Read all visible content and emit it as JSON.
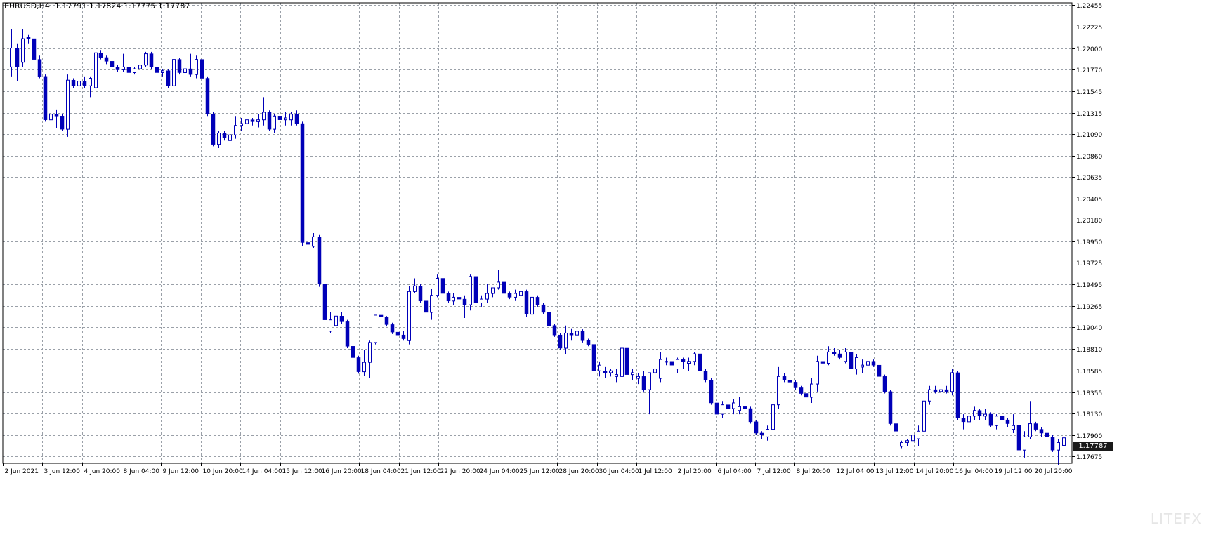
{
  "title_line": "EURUSD,H4  1.17791 1.17824 1.17775 1.17787",
  "current_price": "1.17787",
  "watermark": "LITEFX",
  "colors": {
    "candle": "#0000b8",
    "grid": "#9aa0a8",
    "background": "#ffffff",
    "axis": "#000000",
    "current_price_line": "#a0a8b8",
    "current_price_box": "#1a1a1a"
  },
  "chart_data": {
    "type": "candlestick",
    "symbol": "EURUSD",
    "timeframe": "H4",
    "ylim": [
      1.176,
      1.2248
    ],
    "price_ticks": [
      "1.22455",
      "1.22225",
      "1.22000",
      "1.21770",
      "1.21545",
      "1.21315",
      "1.21090",
      "1.20860",
      "1.20635",
      "1.20405",
      "1.20180",
      "1.19950",
      "1.19725",
      "1.19495",
      "1.19265",
      "1.19040",
      "1.18810",
      "1.18585",
      "1.18355",
      "1.18130",
      "1.17900",
      "1.17675"
    ],
    "time_ticks": [
      "2 Jun 2021",
      "3 Jun 12:00",
      "4 Jun 20:00",
      "8 Jun 04:00",
      "9 Jun 12:00",
      "10 Jun 20:00",
      "14 Jun 04:00",
      "15 Jun 12:00",
      "16 Jun 20:00",
      "18 Jun 04:00",
      "21 Jun 12:00",
      "22 Jun 20:00",
      "24 Jun 04:00",
      "25 Jun 12:00",
      "28 Jun 20:00",
      "30 Jun 04:00",
      "1 Jul 12:00",
      "2 Jul 20:00",
      "6 Jul 04:00",
      "7 Jul 12:00",
      "8 Jul 20:00",
      "12 Jul 04:00",
      "13 Jul 12:00",
      "14 Jul 20:00",
      "16 Jul 04:00",
      "19 Jul 12:00",
      "20 Jul 20:00"
    ],
    "candles": [
      [
        1.218,
        1.222,
        1.217,
        1.22
      ],
      [
        1.22,
        1.2205,
        1.2165,
        1.218
      ],
      [
        1.2185,
        1.222,
        1.218,
        1.221
      ],
      [
        1.2212,
        1.2214,
        1.2205,
        1.221
      ],
      [
        1.221,
        1.2212,
        1.2185,
        1.2188
      ],
      [
        1.2188,
        1.2192,
        1.2168,
        1.217
      ],
      [
        1.217,
        1.2172,
        1.2122,
        1.2124
      ],
      [
        1.2124,
        1.214,
        1.212,
        1.213
      ],
      [
        1.213,
        1.2135,
        1.2115,
        1.2128
      ],
      [
        1.2128,
        1.213,
        1.2112,
        1.2114
      ],
      [
        1.2114,
        1.2172,
        1.2106,
        1.2166
      ],
      [
        1.2166,
        1.2168,
        1.2158,
        1.216
      ],
      [
        1.216,
        1.2168,
        1.2152,
        1.2165
      ],
      [
        1.2165,
        1.217,
        1.2158,
        1.216
      ],
      [
        1.216,
        1.217,
        1.2148,
        1.2168
      ],
      [
        1.2158,
        1.2202,
        1.2155,
        1.2195
      ],
      [
        1.2195,
        1.2198,
        1.2188,
        1.219
      ],
      [
        1.219,
        1.2192,
        1.2183,
        1.2186
      ],
      [
        1.2186,
        1.2188,
        1.2178,
        1.218
      ],
      [
        1.218,
        1.2182,
        1.2175,
        1.2177
      ],
      [
        1.2177,
        1.2194,
        1.2175,
        1.218
      ],
      [
        1.218,
        1.2182,
        1.2172,
        1.2174
      ],
      [
        1.2174,
        1.218,
        1.2172,
        1.2178
      ],
      [
        1.2178,
        1.2184,
        1.2172,
        1.2182
      ],
      [
        1.2182,
        1.2196,
        1.218,
        1.2194
      ],
      [
        1.2194,
        1.2196,
        1.2178,
        1.218
      ],
      [
        1.218,
        1.2185,
        1.2172,
        1.2174
      ],
      [
        1.2174,
        1.2178,
        1.217,
        1.2176
      ],
      [
        1.2176,
        1.2178,
        1.2158,
        1.216
      ],
      [
        1.216,
        1.2192,
        1.2152,
        1.2188
      ],
      [
        1.2188,
        1.219,
        1.2172,
        1.2174
      ],
      [
        1.2174,
        1.2182,
        1.2168,
        1.2178
      ],
      [
        1.2178,
        1.2194,
        1.217,
        1.2172
      ],
      [
        1.2172,
        1.2192,
        1.2168,
        1.2188
      ],
      [
        1.2188,
        1.219,
        1.2166,
        1.2168
      ],
      [
        1.2168,
        1.217,
        1.2128,
        1.213
      ],
      [
        1.213,
        1.2132,
        1.2096,
        1.2098
      ],
      [
        1.2098,
        1.2112,
        1.2094,
        1.211
      ],
      [
        1.211,
        1.2112,
        1.2102,
        1.2105
      ],
      [
        1.2102,
        1.2112,
        1.2096,
        1.2108
      ],
      [
        1.2108,
        1.2128,
        1.2104,
        1.2118
      ],
      [
        1.2118,
        1.2126,
        1.2112,
        1.212
      ],
      [
        1.212,
        1.2132,
        1.2116,
        1.2124
      ],
      [
        1.2124,
        1.2126,
        1.2118,
        1.2122
      ],
      [
        1.2122,
        1.213,
        1.2116,
        1.2124
      ],
      [
        1.2124,
        1.2148,
        1.2118,
        1.2132
      ],
      [
        1.2132,
        1.2134,
        1.2112,
        1.2114
      ],
      [
        1.2114,
        1.213,
        1.211,
        1.2128
      ],
      [
        1.2128,
        1.213,
        1.212,
        1.2124
      ],
      [
        1.2124,
        1.2132,
        1.2118,
        1.2126
      ],
      [
        1.2124,
        1.2132,
        1.2118,
        1.213
      ],
      [
        1.213,
        1.2134,
        1.2118,
        1.212
      ],
      [
        1.212,
        1.2122,
        1.199,
        1.1994
      ],
      [
        1.1994,
        1.1996,
        1.1988,
        1.1992
      ],
      [
        1.199,
        1.2004,
        1.1988,
        1.2
      ],
      [
        1.2,
        1.2002,
        1.1947,
        1.195
      ],
      [
        1.195,
        1.1952,
        1.191,
        1.1912
      ],
      [
        1.19,
        1.192,
        1.1898,
        1.1912
      ],
      [
        1.1906,
        1.1922,
        1.19,
        1.1916
      ],
      [
        1.1916,
        1.192,
        1.1908,
        1.191
      ],
      [
        1.191,
        1.1912,
        1.1882,
        1.1884
      ],
      [
        1.1884,
        1.1886,
        1.187,
        1.1872
      ],
      [
        1.1872,
        1.1874,
        1.1855,
        1.1857
      ],
      [
        1.1857,
        1.188,
        1.1853,
        1.1867
      ],
      [
        1.1867,
        1.189,
        1.185,
        1.1888
      ],
      [
        1.1888,
        1.191,
        1.1886,
        1.1917
      ],
      [
        1.1917,
        1.1918,
        1.1912,
        1.1915
      ],
      [
        1.1915,
        1.1916,
        1.1905,
        1.1907
      ],
      [
        1.1907,
        1.1909,
        1.1897,
        1.1899
      ],
      [
        1.1899,
        1.1902,
        1.1893,
        1.1896
      ],
      [
        1.1896,
        1.19,
        1.189,
        1.1892
      ],
      [
        1.189,
        1.1948,
        1.1886,
        1.1942
      ],
      [
        1.1942,
        1.1956,
        1.194,
        1.1948
      ],
      [
        1.1948,
        1.195,
        1.193,
        1.1932
      ],
      [
        1.1932,
        1.1935,
        1.1918,
        1.192
      ],
      [
        1.192,
        1.1945,
        1.1912,
        1.1938
      ],
      [
        1.1938,
        1.196,
        1.1936,
        1.1956
      ],
      [
        1.1956,
        1.1958,
        1.1938,
        1.194
      ],
      [
        1.194,
        1.1942,
        1.193,
        1.1932
      ],
      [
        1.1932,
        1.194,
        1.1928,
        1.1936
      ],
      [
        1.1936,
        1.194,
        1.193,
        1.1934
      ],
      [
        1.1934,
        1.1938,
        1.1914,
        1.1928
      ],
      [
        1.1928,
        1.196,
        1.1922,
        1.1958
      ],
      [
        1.1958,
        1.196,
        1.1928,
        1.193
      ],
      [
        1.193,
        1.1938,
        1.1926,
        1.1934
      ],
      [
        1.1934,
        1.195,
        1.193,
        1.194
      ],
      [
        1.194,
        1.1946,
        1.1936,
        1.1946
      ],
      [
        1.1946,
        1.1965,
        1.1944,
        1.1952
      ],
      [
        1.1952,
        1.1955,
        1.1938,
        1.194
      ],
      [
        1.194,
        1.1942,
        1.1934,
        1.1936
      ],
      [
        1.1936,
        1.1944,
        1.1932,
        1.194
      ],
      [
        1.1938,
        1.1944,
        1.192,
        1.1942
      ],
      [
        1.1942,
        1.1944,
        1.1915,
        1.1918
      ],
      [
        1.1918,
        1.1944,
        1.1914,
        1.1936
      ],
      [
        1.1936,
        1.1938,
        1.1926,
        1.1928
      ],
      [
        1.1928,
        1.193,
        1.1918,
        1.192
      ],
      [
        1.192,
        1.1922,
        1.1904,
        1.1906
      ],
      [
        1.1906,
        1.1908,
        1.1894,
        1.1896
      ],
      [
        1.1896,
        1.1898,
        1.188,
        1.1882
      ],
      [
        1.1882,
        1.1906,
        1.1876,
        1.1898
      ],
      [
        1.1898,
        1.1903,
        1.189,
        1.1896
      ],
      [
        1.1896,
        1.1902,
        1.189,
        1.19
      ],
      [
        1.19,
        1.1902,
        1.1888,
        1.189
      ],
      [
        1.189,
        1.1892,
        1.1884,
        1.1886
      ],
      [
        1.1886,
        1.1888,
        1.1856,
        1.1858
      ],
      [
        1.1858,
        1.1868,
        1.1852,
        1.1864
      ],
      [
        1.1858,
        1.1862,
        1.185,
        1.1856
      ],
      [
        1.1856,
        1.186,
        1.1852,
        1.1858
      ],
      [
        1.1852,
        1.186,
        1.1846,
        1.1854
      ],
      [
        1.1852,
        1.1886,
        1.1848,
        1.1882
      ],
      [
        1.1882,
        1.1884,
        1.1852,
        1.1854
      ],
      [
        1.1854,
        1.186,
        1.1848,
        1.1856
      ],
      [
        1.185,
        1.1856,
        1.1844,
        1.1852
      ],
      [
        1.1852,
        1.1858,
        1.1836,
        1.1838
      ],
      [
        1.1838,
        1.1856,
        1.1812,
        1.1856
      ],
      [
        1.1856,
        1.187,
        1.1852,
        1.186
      ],
      [
        1.185,
        1.1878,
        1.1846,
        1.187
      ],
      [
        1.1868,
        1.1872,
        1.1864,
        1.1868
      ],
      [
        1.1868,
        1.1872,
        1.1856,
        1.1864
      ],
      [
        1.186,
        1.1872,
        1.1856,
        1.187
      ],
      [
        1.187,
        1.1872,
        1.186,
        1.1868
      ],
      [
        1.1866,
        1.1872,
        1.1858,
        1.1868
      ],
      [
        1.1868,
        1.1878,
        1.1864,
        1.1876
      ],
      [
        1.1876,
        1.1878,
        1.1856,
        1.1858
      ],
      [
        1.1858,
        1.186,
        1.1846,
        1.1848
      ],
      [
        1.1848,
        1.185,
        1.1822,
        1.1824
      ],
      [
        1.1824,
        1.1828,
        1.181,
        1.1812
      ],
      [
        1.1812,
        1.1826,
        1.1808,
        1.1822
      ],
      [
        1.1822,
        1.1824,
        1.1816,
        1.1818
      ],
      [
        1.1818,
        1.1828,
        1.1812,
        1.1824
      ],
      [
        1.1816,
        1.183,
        1.1812,
        1.182
      ],
      [
        1.182,
        1.1822,
        1.1816,
        1.1818
      ],
      [
        1.1818,
        1.182,
        1.1802,
        1.1804
      ],
      [
        1.1804,
        1.1806,
        1.179,
        1.1792
      ],
      [
        1.1792,
        1.1794,
        1.1786,
        1.179
      ],
      [
        1.1788,
        1.18,
        1.1784,
        1.1796
      ],
      [
        1.1796,
        1.1828,
        1.179,
        1.1822
      ],
      [
        1.1822,
        1.1862,
        1.1818,
        1.1852
      ],
      [
        1.1852,
        1.1856,
        1.1846,
        1.1848
      ],
      [
        1.1848,
        1.185,
        1.1842,
        1.1846
      ],
      [
        1.1846,
        1.1848,
        1.1838,
        1.184
      ],
      [
        1.184,
        1.1842,
        1.1832,
        1.1834
      ],
      [
        1.1834,
        1.1836,
        1.1826,
        1.183
      ],
      [
        1.183,
        1.185,
        1.1824,
        1.1844
      ],
      [
        1.1844,
        1.1874,
        1.1836,
        1.1868
      ],
      [
        1.1868,
        1.1872,
        1.1864,
        1.1866
      ],
      [
        1.1866,
        1.1884,
        1.1864,
        1.1878
      ],
      [
        1.1878,
        1.1882,
        1.1874,
        1.1876
      ],
      [
        1.1876,
        1.188,
        1.187,
        1.1872
      ],
      [
        1.1868,
        1.1882,
        1.1866,
        1.1878
      ],
      [
        1.1878,
        1.188,
        1.1856,
        1.186
      ],
      [
        1.186,
        1.1876,
        1.1854,
        1.1872
      ],
      [
        1.1862,
        1.187,
        1.1856,
        1.1864
      ],
      [
        1.1864,
        1.1872,
        1.1862,
        1.1868
      ],
      [
        1.1868,
        1.187,
        1.1862,
        1.1864
      ],
      [
        1.1864,
        1.1866,
        1.185,
        1.1852
      ],
      [
        1.1852,
        1.1854,
        1.1834,
        1.1836
      ],
      [
        1.1836,
        1.1838,
        1.18,
        1.1802
      ],
      [
        1.1802,
        1.182,
        1.1784,
        1.1794
      ],
      [
        1.1778,
        1.1784,
        1.1776,
        1.1782
      ],
      [
        1.1782,
        1.1786,
        1.1778,
        1.1784
      ],
      [
        1.1784,
        1.1792,
        1.178,
        1.179
      ],
      [
        1.1786,
        1.18,
        1.1778,
        1.1794
      ],
      [
        1.1794,
        1.1832,
        1.178,
        1.1826
      ],
      [
        1.1826,
        1.1842,
        1.1822,
        1.1838
      ],
      [
        1.1838,
        1.1842,
        1.1834,
        1.1836
      ],
      [
        1.1836,
        1.184,
        1.1832,
        1.1838
      ],
      [
        1.1838,
        1.1842,
        1.1834,
        1.1836
      ],
      [
        1.1836,
        1.186,
        1.1832,
        1.1856
      ],
      [
        1.1856,
        1.1858,
        1.1806,
        1.1808
      ],
      [
        1.1808,
        1.1812,
        1.1796,
        1.1804
      ],
      [
        1.1804,
        1.1816,
        1.18,
        1.181
      ],
      [
        1.181,
        1.182,
        1.1806,
        1.1816
      ],
      [
        1.1816,
        1.1818,
        1.1806,
        1.181
      ],
      [
        1.181,
        1.1818,
        1.1806,
        1.1812
      ],
      [
        1.1812,
        1.1814,
        1.1798,
        1.18
      ],
      [
        1.18,
        1.1812,
        1.1796,
        1.181
      ],
      [
        1.181,
        1.1814,
        1.1804,
        1.1806
      ],
      [
        1.1806,
        1.1808,
        1.1798,
        1.1802
      ],
      [
        1.1796,
        1.1812,
        1.1792,
        1.18
      ],
      [
        1.18,
        1.1802,
        1.177,
        1.1774
      ],
      [
        1.1774,
        1.1794,
        1.1766,
        1.1788
      ],
      [
        1.1788,
        1.1826,
        1.1786,
        1.1802
      ],
      [
        1.1802,
        1.1804,
        1.1794,
        1.1796
      ],
      [
        1.1796,
        1.1798,
        1.1788,
        1.1792
      ],
      [
        1.1792,
        1.1794,
        1.1786,
        1.1788
      ],
      [
        1.1788,
        1.179,
        1.1772,
        1.1774
      ],
      [
        1.1774,
        1.1786,
        1.1758,
        1.1782
      ],
      [
        1.1779,
        1.179,
        1.1776,
        1.1787
      ]
    ]
  }
}
